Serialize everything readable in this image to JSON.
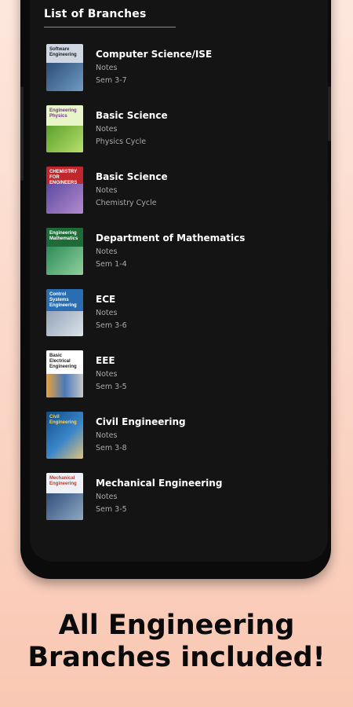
{
  "header": {
    "title": "List of Branches"
  },
  "branches": [
    {
      "name": "Computer Science/ISE",
      "type": "Notes",
      "detail": "Sem 3-7",
      "cover_title": "Software Engineering"
    },
    {
      "name": "Basic Science",
      "type": "Notes",
      "detail": "Physics Cycle",
      "cover_title": "Engineering Physics"
    },
    {
      "name": "Basic Science",
      "type": "Notes",
      "detail": "Chemistry Cycle",
      "cover_title": "CHEMISTRY FOR ENGINEERS"
    },
    {
      "name": "Department of Mathematics",
      "type": "Notes",
      "detail": "Sem 1-4",
      "cover_title": "Engineering Mathematics"
    },
    {
      "name": "ECE",
      "type": "Notes",
      "detail": "Sem 3-6",
      "cover_title": "Control Systems Engineering"
    },
    {
      "name": "EEE",
      "type": "Notes",
      "detail": "Sem 3-5",
      "cover_title": "Basic Electrical Engineering"
    },
    {
      "name": "Civil Engineering",
      "type": "Notes",
      "detail": "Sem 3-8",
      "cover_title": "Civil Engineering"
    },
    {
      "name": "Mechanical Engineering",
      "type": "Notes",
      "detail": "Sem 3-5",
      "cover_title": "Mechanical Engineering"
    }
  ],
  "caption": {
    "line1": "All Engineering",
    "line2": "Branches included!"
  },
  "colors": {
    "background_top": "#fde7dd",
    "background_bottom": "#f9c8b3",
    "screen": "#141414",
    "text_primary": "#ffffff",
    "text_secondary": "#a9a9a9"
  }
}
